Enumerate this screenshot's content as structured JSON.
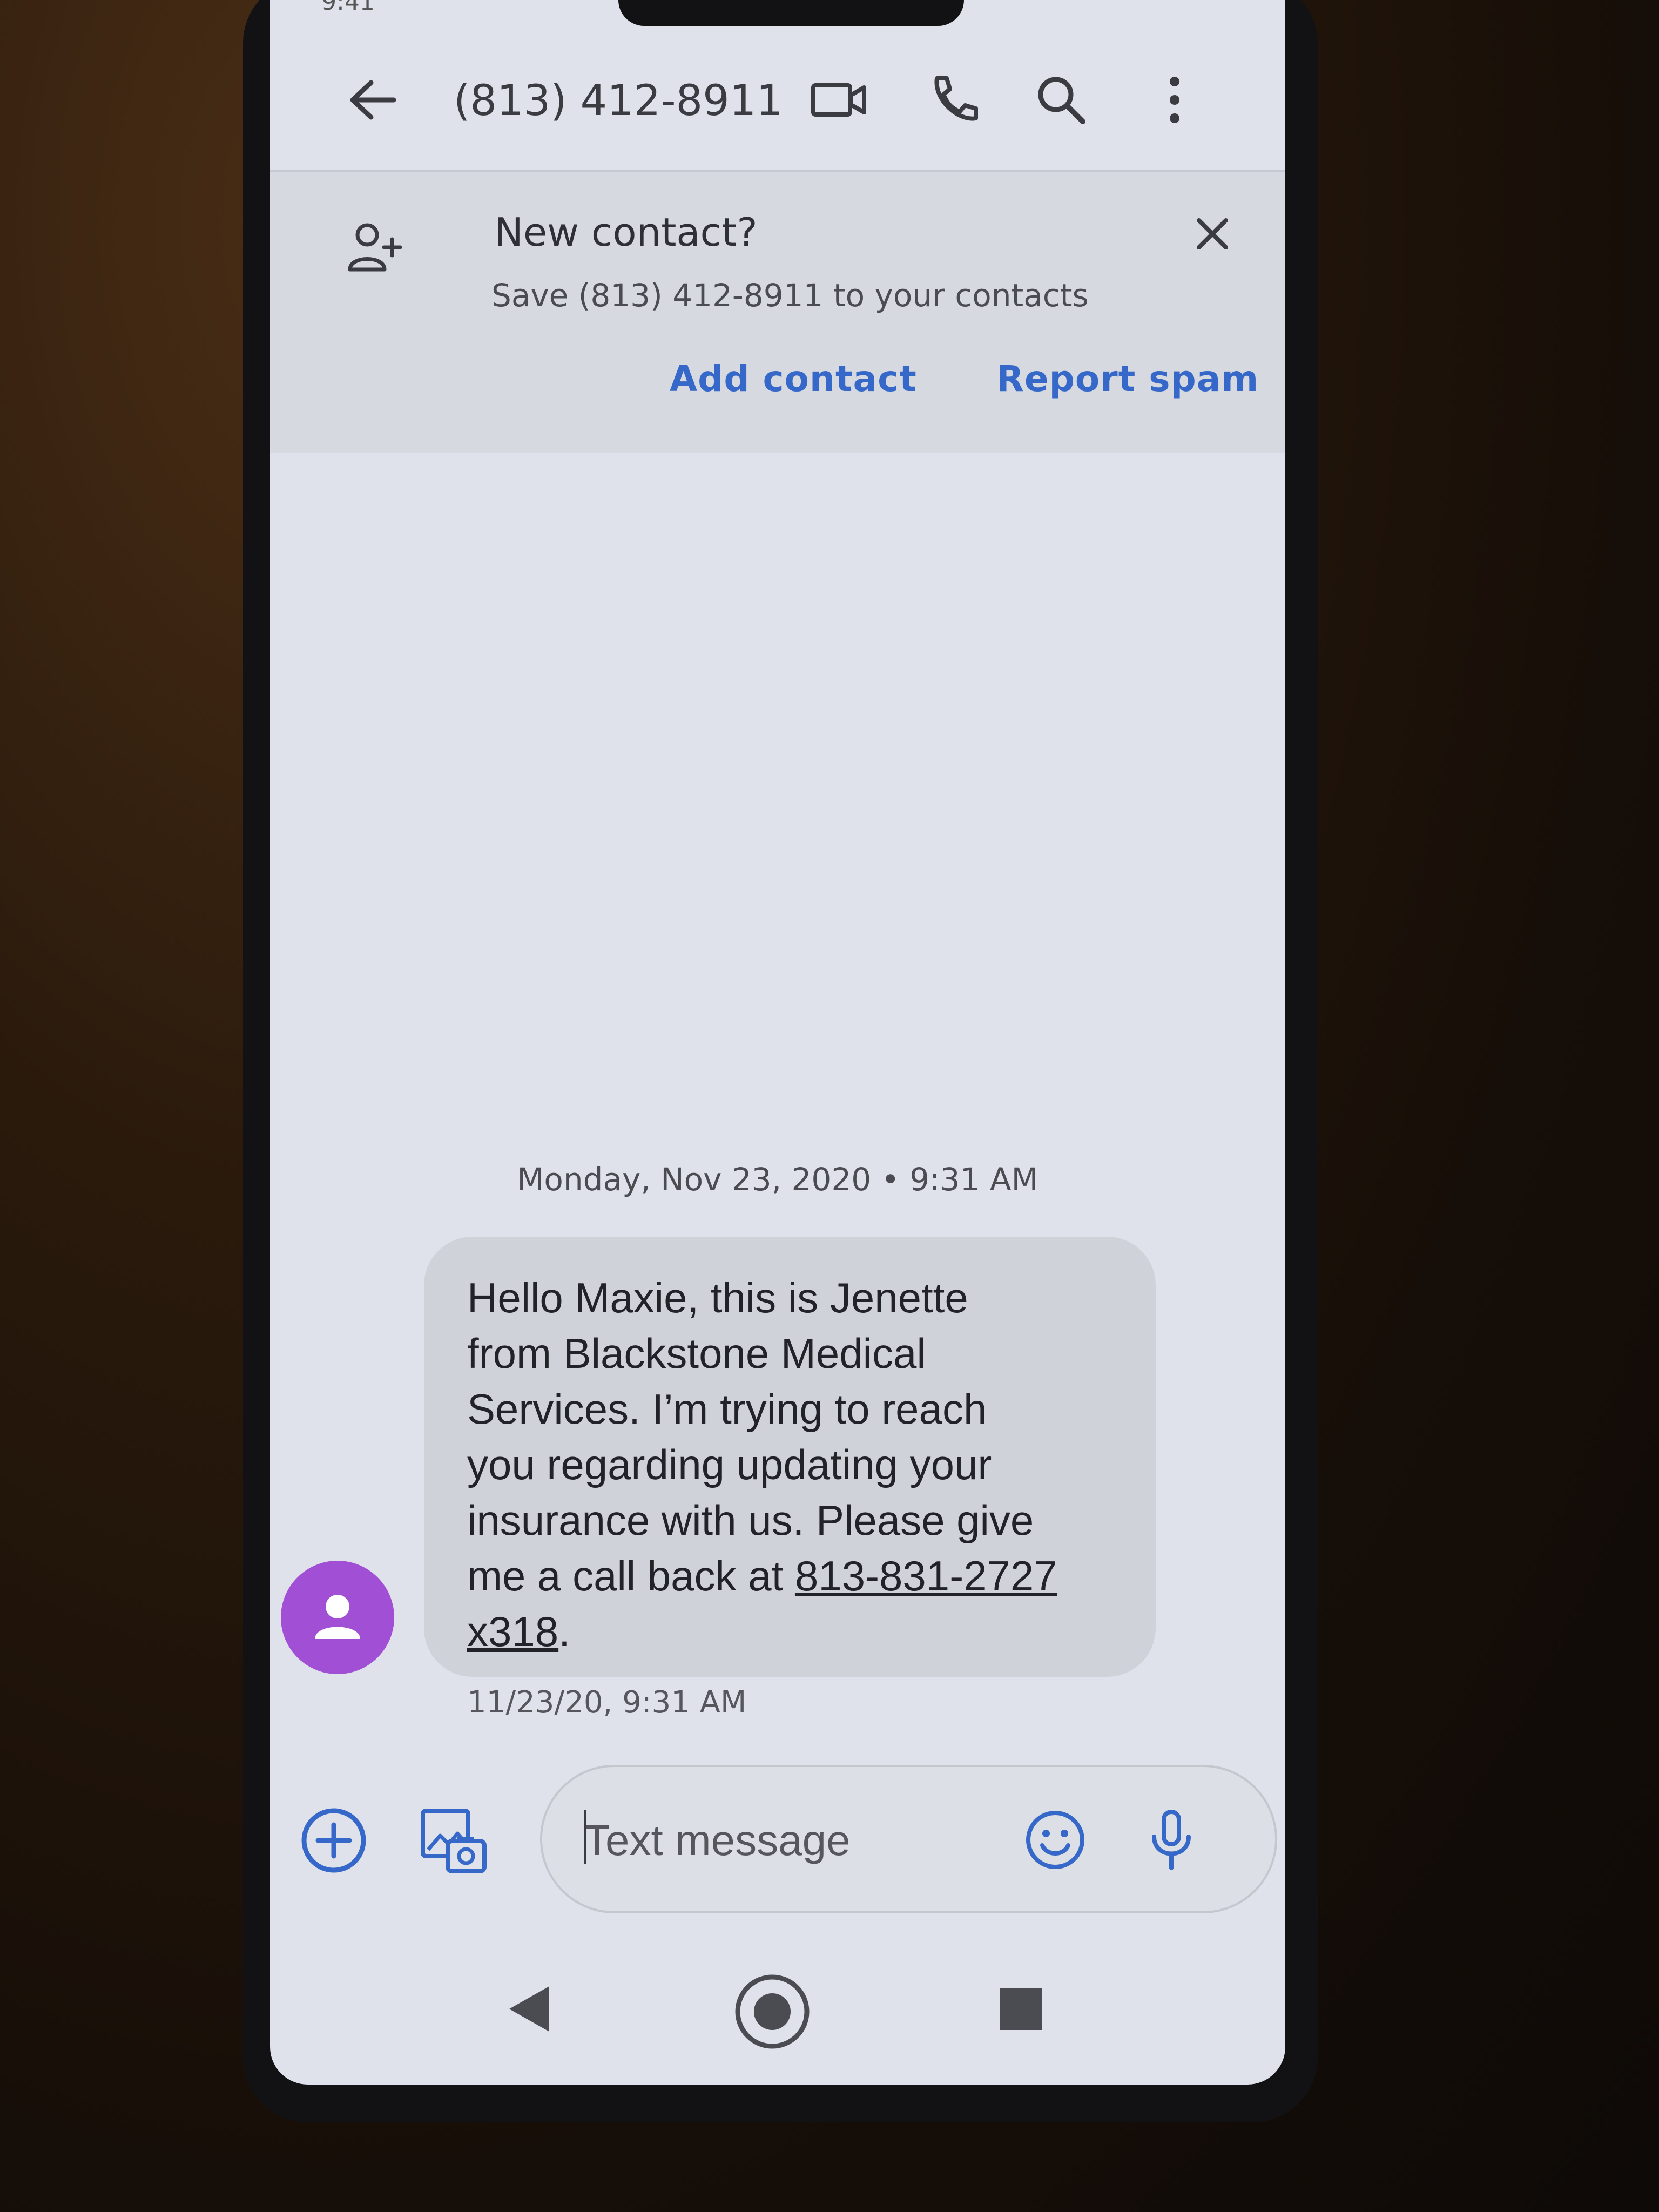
{
  "status": {
    "time": "9:41"
  },
  "header": {
    "title": "(813) 412-8911",
    "icons": [
      "back-arrow-icon",
      "video-call-icon",
      "phone-icon",
      "search-icon",
      "more-vert-icon"
    ]
  },
  "banner": {
    "icon": "add-person-icon",
    "title": "New contact?",
    "subtitle": "Save (813) 412-8911 to your contacts",
    "add_contact_label": "Add contact",
    "report_spam_label": "Report spam",
    "close_icon": "close-icon"
  },
  "conversation": {
    "date_separator": "Monday, Nov 23, 2020 • 9:31 AM",
    "messages": [
      {
        "sender_avatar": "person-avatar-icon",
        "avatar_color": "#a150d6",
        "text_lines": [
          "Hello Maxie, this is Jenette",
          "from Blackstone Medical",
          "Services. I’m trying to reach",
          "you regarding updating your",
          "insurance with us. Please give"
        ],
        "text_prefix": "me a call back at ",
        "link_part1": "813-831-2727",
        "link_part2": "x318",
        "text_suffix": ".",
        "timestamp": "11/23/20, 9:31 AM"
      }
    ]
  },
  "compose": {
    "placeholder": "Text message",
    "icons": [
      "add-circle-icon",
      "gallery-icon",
      "emoji-icon",
      "mic-icon"
    ]
  },
  "navbar": {
    "icons": [
      "nav-back-icon",
      "nav-home-icon",
      "nav-recents-icon"
    ]
  },
  "colors": {
    "accent": "#3568c8",
    "avatar": "#a150d6",
    "screen_bg": "#dfe2ea",
    "bubble_bg": "#cfd2d9"
  }
}
